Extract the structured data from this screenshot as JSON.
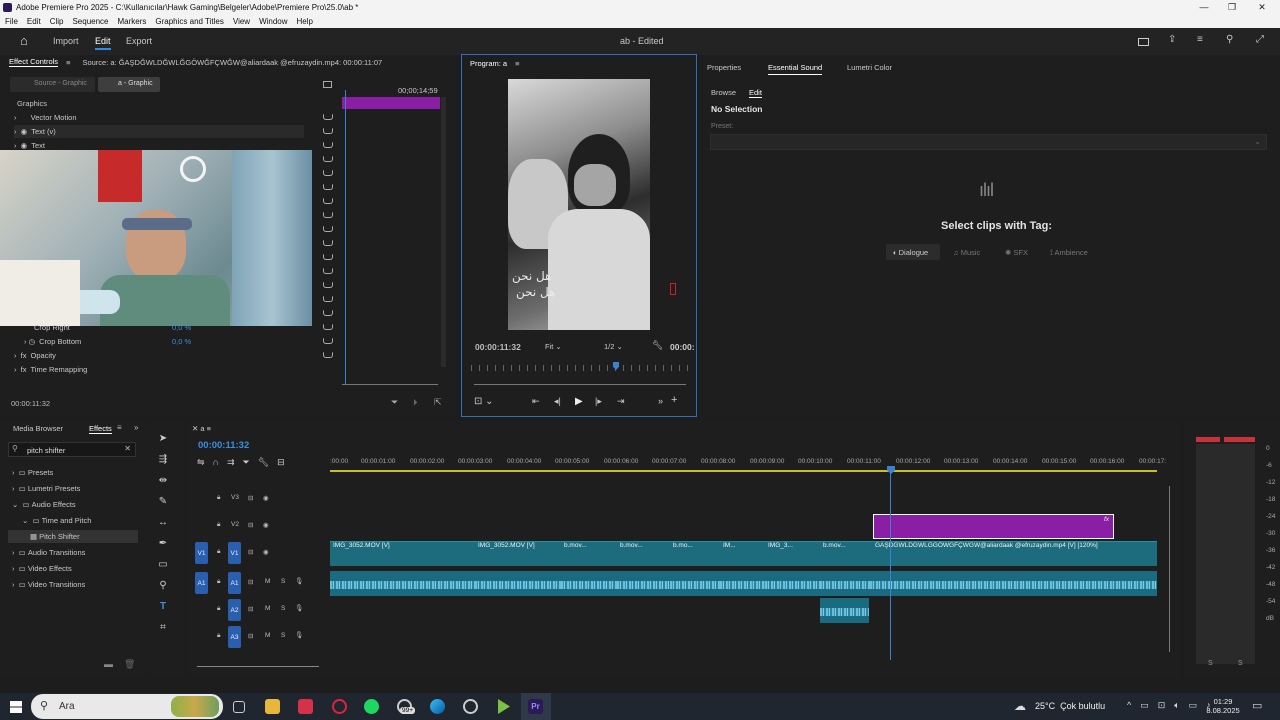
{
  "titlebar": {
    "title": "Adobe Premiere Pro 2025 - C:\\Kullanıcılar\\Hawk Gaming\\Belgeler\\Adobe\\Premiere Pro\\25.0\\ab *",
    "minimize": "—",
    "restore": "❐",
    "close": "✕"
  },
  "menu": [
    "File",
    "Edit",
    "Clip",
    "Sequence",
    "Markers",
    "Graphics and Titles",
    "View",
    "Window",
    "Help"
  ],
  "header": {
    "home": "⌂",
    "import": "Import",
    "edit": "Edit",
    "export": "Export",
    "project": "ab - Edited"
  },
  "effect_controls": {
    "tab": "Effect Controls",
    "source": "Source: a: ĞAŞDĞWLDĞWLĞGÖWĞFÇWĞW@aliardaak @efruzaydin.mp4: 00:00:11:07",
    "source_chip": "Source - Graphic",
    "seq_chip": "a - Graphic",
    "timecode_end": "00;00;14;59",
    "section": "Graphics",
    "rows": [
      {
        "label": "Vector Motion"
      },
      {
        "label": "Text (v)"
      },
      {
        "label": "Text"
      }
    ],
    "crop_rows": [
      {
        "label": "Crop Right",
        "value": "0,0 %"
      },
      {
        "label": "Crop Bottom",
        "value": "0,0 %"
      }
    ],
    "opacity": "Opacity",
    "time_remap": "Time Remapping",
    "current_time": "00:00:11:32"
  },
  "program": {
    "tab": "Program: a",
    "timecode": "00:00:11:32",
    "fit": "Fit",
    "res": "1/2",
    "right_tc": "00:00:",
    "caption_line1": "هل نحن",
    "caption_line2": "هل نحن"
  },
  "essential": {
    "tabs": [
      "Properties",
      "Essential Sound",
      "Lumetri Color"
    ],
    "subtabs": [
      "Browse",
      "Edit"
    ],
    "no_selection": "No Selection",
    "preset": "Preset:",
    "select_clips": "Select clips with Tag:",
    "tags": [
      "Dialogue",
      "Music",
      "SFX",
      "Ambience"
    ]
  },
  "effects_panel": {
    "tabs": [
      "Media Browser",
      "Effects"
    ],
    "search": "pitch shifter",
    "tree": [
      {
        "label": "Presets",
        "level": 0
      },
      {
        "label": "Lumetri Presets",
        "level": 0
      },
      {
        "label": "Audio Effects",
        "level": 0
      },
      {
        "label": "Time and Pitch",
        "level": 1
      },
      {
        "label": "Pitch Shifter",
        "level": 2
      },
      {
        "label": "Audio Transitions",
        "level": 0
      },
      {
        "label": "Video Effects",
        "level": 0
      },
      {
        "label": "Video Transitions",
        "level": 0
      }
    ]
  },
  "timeline": {
    "tab": "a",
    "timecode": "00:00:11:32",
    "ruler": [
      ":00:00",
      "00:00:01:00",
      "00:00:02:00",
      "00:00:03:00",
      "00:00:04:00",
      "00:00:05:00",
      "00:00:06:00",
      "00:00:07:00",
      "00:00:08:00",
      "00:00:09:00",
      "00:00:10:00",
      "00:00:11:00",
      "00:00:12:00",
      "00:00:13:00",
      "00:00:14:00",
      "00:00:15:00",
      "00:00:16:00",
      "00:00:17:"
    ],
    "tracks": [
      "V3",
      "V2",
      "V1",
      "A1",
      "A2",
      "A3"
    ],
    "src_v1": "V1",
    "src_a1": "A1",
    "clips": [
      "IMG_3052.MOV [V]",
      "IMG_3052.MOV [V]",
      "b.mov...",
      "b.mov...",
      "b.mo...",
      "IM...",
      "IMG_3...",
      "b.mov...",
      "ĞAŞDĞWLDĞWLĞGÖWĞFÇWĞW@aliardaak @efruzaydin.mp4 [V] [120%]"
    ],
    "fx": "fx",
    "m": "M",
    "s": "S"
  },
  "meter": {
    "scale": [
      "0",
      "-6",
      "-12",
      "-18",
      "-24",
      "-30",
      "-36",
      "-42",
      "-48",
      "-54",
      "dB"
    ],
    "solo": [
      "S",
      "S"
    ]
  },
  "taskbar": {
    "search": "Ara",
    "weather": "25°C  Çok bulutlu",
    "time": "01:29",
    "date": "8.08.2025",
    "badge": "99+"
  }
}
